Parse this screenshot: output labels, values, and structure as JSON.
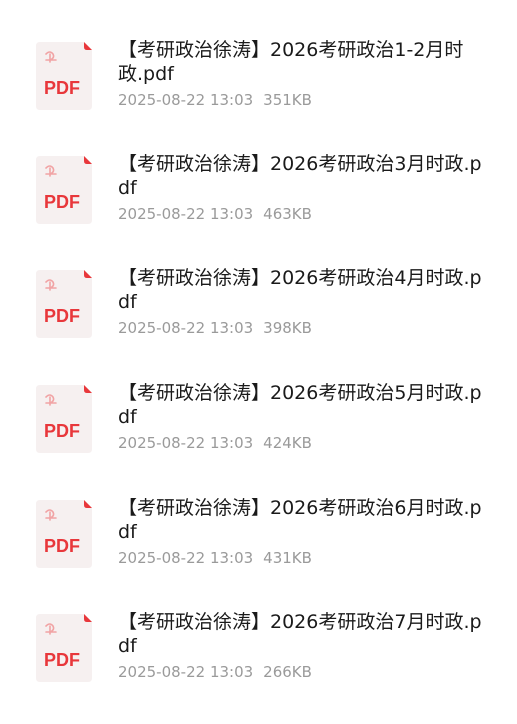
{
  "icon": {
    "name": "pdf-file-icon",
    "label": "PDF",
    "accent": "#e8373b",
    "background": "#f7f2f2"
  },
  "files": [
    {
      "name": "【考研政治徐涛】2026考研政治1-2月时政.pdf",
      "date": "2025-08-22 13:03",
      "size": "351KB"
    },
    {
      "name": "【考研政治徐涛】2026考研政治3月时政.pdf",
      "date": "2025-08-22 13:03",
      "size": "463KB"
    },
    {
      "name": "【考研政治徐涛】2026考研政治4月时政.pdf",
      "date": "2025-08-22 13:03",
      "size": "398KB"
    },
    {
      "name": "【考研政治徐涛】2026考研政治5月时政.pdf",
      "date": "2025-08-22 13:03",
      "size": "424KB"
    },
    {
      "name": "【考研政治徐涛】2026考研政治6月时政.pdf",
      "date": "2025-08-22 13:03",
      "size": "431KB"
    },
    {
      "name": "【考研政治徐涛】2026考研政治7月时政.pdf",
      "date": "2025-08-22 13:03",
      "size": "266KB"
    }
  ]
}
